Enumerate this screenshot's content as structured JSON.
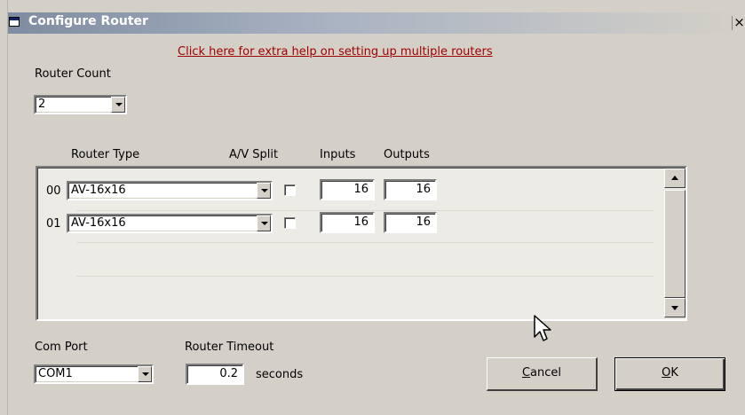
{
  "window": {
    "title": "Configure Router",
    "close_glyph": "×"
  },
  "help_link": "Click here for extra help on setting up multiple routers",
  "router_count": {
    "label": "Router Count",
    "value": "2"
  },
  "columns": {
    "router_type": "Router Type",
    "av_split": "A/V Split",
    "inputs": "Inputs",
    "outputs": "Outputs"
  },
  "routers": [
    {
      "num": "00",
      "type": "AV-16x16",
      "av_split": false,
      "inputs": "16",
      "outputs": "16"
    },
    {
      "num": "01",
      "type": "AV-16x16",
      "av_split": false,
      "inputs": "16",
      "outputs": "16"
    }
  ],
  "com_port": {
    "label": "Com Port",
    "value": "COM1"
  },
  "router_timeout": {
    "label": "Router Timeout",
    "value": "0.2",
    "unit": "seconds"
  },
  "buttons": {
    "cancel": {
      "prefix": "",
      "accel": "C",
      "rest": "ancel"
    },
    "ok": {
      "prefix": "",
      "accel": "O",
      "rest": "K"
    }
  },
  "colors": {
    "dialog_bg": "#d4d0c8",
    "link": "#a00000",
    "title_gradient_start": "#7e8ba0"
  },
  "icons": {
    "window_icon": "window-icon",
    "scroll_up": "scroll-up-arrow-icon",
    "scroll_down": "scroll-down-arrow-icon",
    "dropdown": "chevron-down-icon",
    "cursor": "mouse-pointer-icon"
  }
}
